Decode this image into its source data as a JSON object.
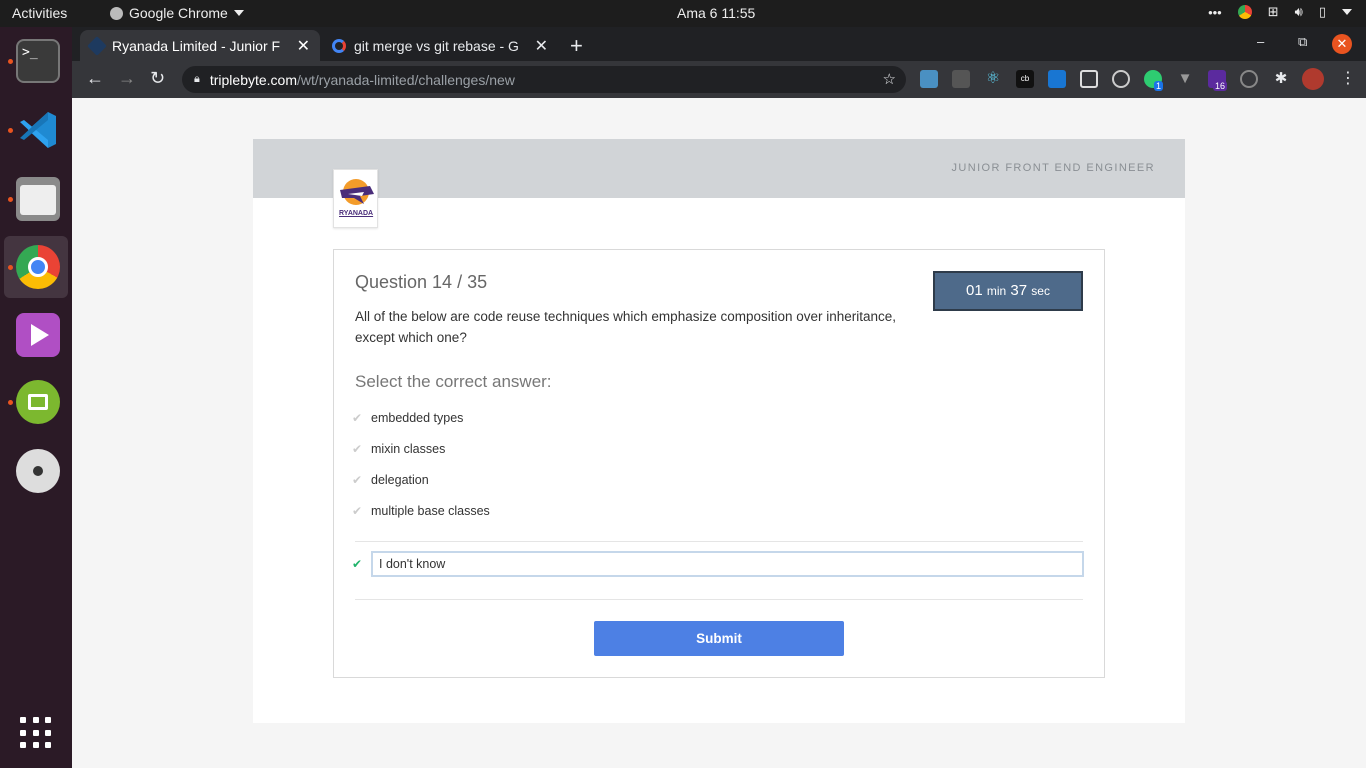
{
  "topbar": {
    "activities": "Activities",
    "app": "Google Chrome",
    "clock": "Ama 6  11:55",
    "tray_more": "•••"
  },
  "dock": {
    "apps": [
      "terminal-icon",
      "vscode-icon",
      "files-icon",
      "chrome-icon",
      "video-player-icon",
      "cloud-app-icon",
      "disc-icon",
      "show-apps-icon"
    ]
  },
  "browser": {
    "tabs": [
      {
        "title": "Ryanada Limited - Junior F",
        "active": true
      },
      {
        "title": "git merge vs git rebase - G",
        "active": false
      }
    ],
    "url_domain": "triplebyte.com",
    "url_path": "/wt/ryanada-limited/challenges/new",
    "extension_badges": [
      "1",
      "16"
    ]
  },
  "page": {
    "role": "JUNIOR FRONT END ENGINEER",
    "logo_text": "RYANADA",
    "question_number": "Question 14 / 35",
    "timer": {
      "minutes": "01",
      "min_label": "min",
      "seconds": "37",
      "sec_label": "sec"
    },
    "question_text": "All of the below are code reuse techniques which emphasize composition over inheritance, except which one?",
    "select_label": "Select the correct answer:",
    "options": [
      "embedded types",
      "mixin classes",
      "delegation",
      "multiple base classes"
    ],
    "selected_option": "I don't know",
    "submit_label": "Submit"
  },
  "colors": {
    "submit": "#4d80e4",
    "timer": "#4e6a8a",
    "check_selected": "#20b36b",
    "ubuntu_orange": "#e95420"
  }
}
